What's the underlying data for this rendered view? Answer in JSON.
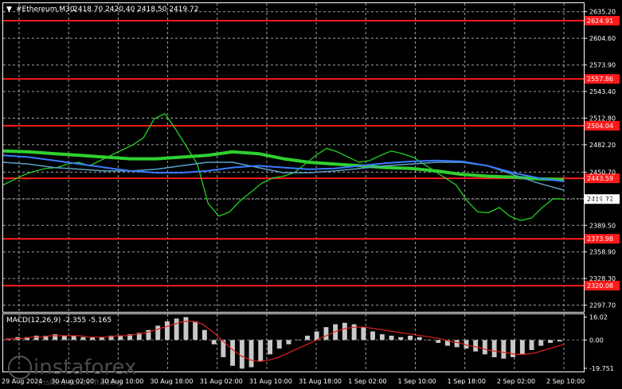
{
  "header": {
    "symbol": "#Ethereum,M30",
    "ohlc": "2418.70 2420.40 2418.50 2419.72"
  },
  "macd_header": "MACD(12,26,9) -2.355 -5.165",
  "watermark": {
    "brand": "instaforex",
    "tagline": "Instant Forex Trading"
  },
  "colors": {
    "background": "#000000",
    "grid": "#c8c8c8",
    "candles": "#22e022",
    "levels": "#ff1a1a",
    "ma_fast": "#3a7bff",
    "ma_slow": "#2fd12f",
    "ma_mid": "#5aa0c8",
    "signal": "#e02020",
    "histogram": "#c8c8c8"
  },
  "chart_data": {
    "type": "line",
    "title": "#Ethereum,M30",
    "price_axis": {
      "ticks": [
        2635.2,
        2604.6,
        2573.9,
        2543.4,
        2512.8,
        2482.2,
        2450.7,
        2420.1,
        2389.5,
        2358.9,
        2328.3,
        2297.7
      ],
      "ylim": [
        2290.0,
        2645.0
      ]
    },
    "time_axis": {
      "labels": [
        "29 Aug 2024",
        "30 Aug 02:00",
        "30 Aug 10:00",
        "30 Aug 18:00",
        "31 Aug 02:00",
        "31 Aug 10:00",
        "31 Aug 18:00",
        "1 Sep 02:00",
        "1 Sep 10:00",
        "1 Sep 18:00",
        "2 Sep 02:00",
        "2 Sep 10:00"
      ]
    },
    "horizontal_levels": [
      {
        "value": 2624.91,
        "label": "2624.91"
      },
      {
        "value": 2557.86,
        "label": "2557.86"
      },
      {
        "value": 2504.04,
        "label": "2504.04"
      },
      {
        "value": 2443.59,
        "label": "2443.59"
      },
      {
        "value": 2373.98,
        "label": "2373.98"
      },
      {
        "value": 2320.08,
        "label": "2320.08"
      }
    ],
    "current_price": {
      "value": 2419.72,
      "label": "2419.72"
    },
    "series": [
      {
        "name": "Price",
        "values": [
          2436,
          2442,
          2448,
          2452,
          2455,
          2456,
          2460,
          2462,
          2458,
          2464,
          2470,
          2476,
          2482,
          2490,
          2512,
          2518,
          2500,
          2480,
          2460,
          2415,
          2400,
          2405,
          2418,
          2428,
          2438,
          2444,
          2446,
          2450,
          2460,
          2470,
          2478,
          2474,
          2468,
          2462,
          2464,
          2470,
          2475,
          2472,
          2468,
          2460,
          2452,
          2444,
          2436,
          2418,
          2405,
          2404,
          2410,
          2400,
          2395,
          2398,
          2410,
          2420,
          2419.72
        ]
      },
      {
        "values": [
          2475,
          2474,
          2472,
          2470,
          2468,
          2466,
          2466,
          2468,
          2470,
          2474,
          2472,
          2466,
          2462,
          2460,
          2458,
          2456,
          2455,
          2452,
          2448,
          2446,
          2445,
          2443,
          2442
        ]
      },
      {
        "values": [
          2462,
          2460,
          2456,
          2454,
          2452,
          2452,
          2454,
          2458,
          2462,
          2462,
          2456,
          2450,
          2450,
          2452,
          2455,
          2458,
          2460,
          2462,
          2462,
          2458,
          2448,
          2438,
          2430
        ]
      },
      {
        "values": [
          2470,
          2468,
          2464,
          2460,
          2456,
          2452,
          2450,
          2450,
          2452,
          2456,
          2458,
          2456,
          2454,
          2455,
          2458,
          2461,
          2463,
          2464,
          2463,
          2458,
          2450,
          2444,
          2440
        ]
      }
    ],
    "macd": {
      "ylim": [
        -22.0,
        18.0
      ],
      "ticks": [
        16.02,
        0.0,
        -19.751
      ],
      "tick_labels": [
        "16.02",
        "0.00",
        "-19.751"
      ],
      "histogram": [
        1,
        2,
        2,
        3,
        3,
        4,
        3,
        3,
        2,
        2,
        2,
        3,
        3,
        4,
        5,
        7,
        10,
        13,
        15,
        16,
        13,
        7,
        -3,
        -12,
        -18,
        -20,
        -19,
        -15,
        -10,
        -6,
        -3,
        0,
        3,
        6,
        9,
        11,
        12,
        11,
        9,
        6,
        4,
        3,
        2,
        3,
        2,
        0,
        -2,
        -4,
        -5,
        -6,
        -8,
        -10,
        -12,
        -13,
        -12,
        -10,
        -7,
        -4,
        -2,
        -1
      ],
      "signal": [
        0,
        1,
        1,
        2,
        2,
        3,
        3,
        3,
        3,
        2,
        2,
        2,
        3,
        3,
        4,
        5,
        7,
        9,
        11,
        13,
        13,
        11,
        6,
        0,
        -6,
        -11,
        -14,
        -15,
        -14,
        -12,
        -9,
        -6,
        -3,
        0,
        3,
        6,
        8,
        9,
        9,
        8,
        7,
        6,
        5,
        4,
        3,
        2,
        1,
        -1,
        -2,
        -4,
        -5,
        -7,
        -8,
        -9,
        -10,
        -10,
        -9,
        -7,
        -5,
        -3
      ]
    }
  }
}
